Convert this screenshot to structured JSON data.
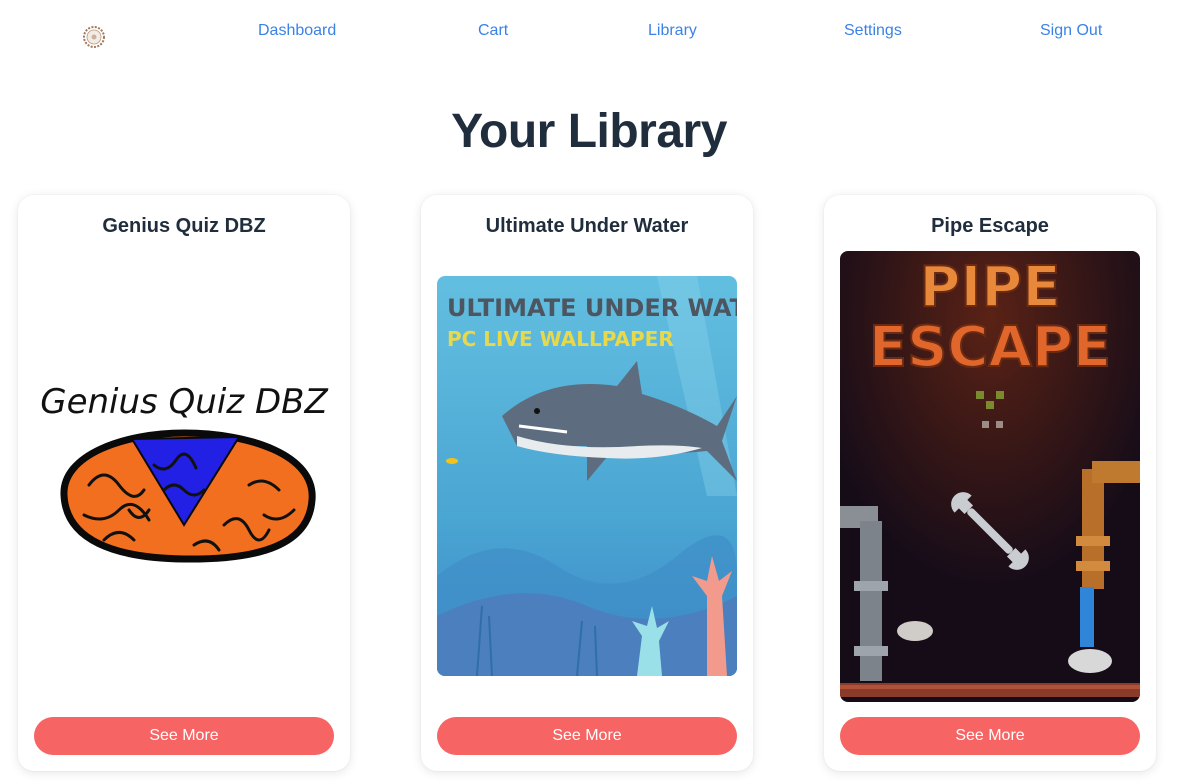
{
  "nav": {
    "items": [
      {
        "label": "Dashboard"
      },
      {
        "label": "Cart"
      },
      {
        "label": "Library"
      },
      {
        "label": "Settings"
      },
      {
        "label": "Sign Out"
      }
    ]
  },
  "page": {
    "title": "Your Library"
  },
  "library": {
    "cards": [
      {
        "title": "Genius Quiz DBZ",
        "cover_text": "Genius Quiz DBZ",
        "button_label": "See More"
      },
      {
        "title": "Ultimate Under Water",
        "cover_text_1": "ULTIMATE UNDER WATER",
        "cover_text_2": "PC LIVE WALLPAPER",
        "button_label": "See More"
      },
      {
        "title": "Pipe Escape",
        "cover_text_1": "PIPE",
        "cover_text_2": "ESCAPE",
        "button_label": "See More"
      }
    ]
  },
  "colors": {
    "link": "#3b82e6",
    "button": "#f76464",
    "title": "#1f2d3d"
  }
}
